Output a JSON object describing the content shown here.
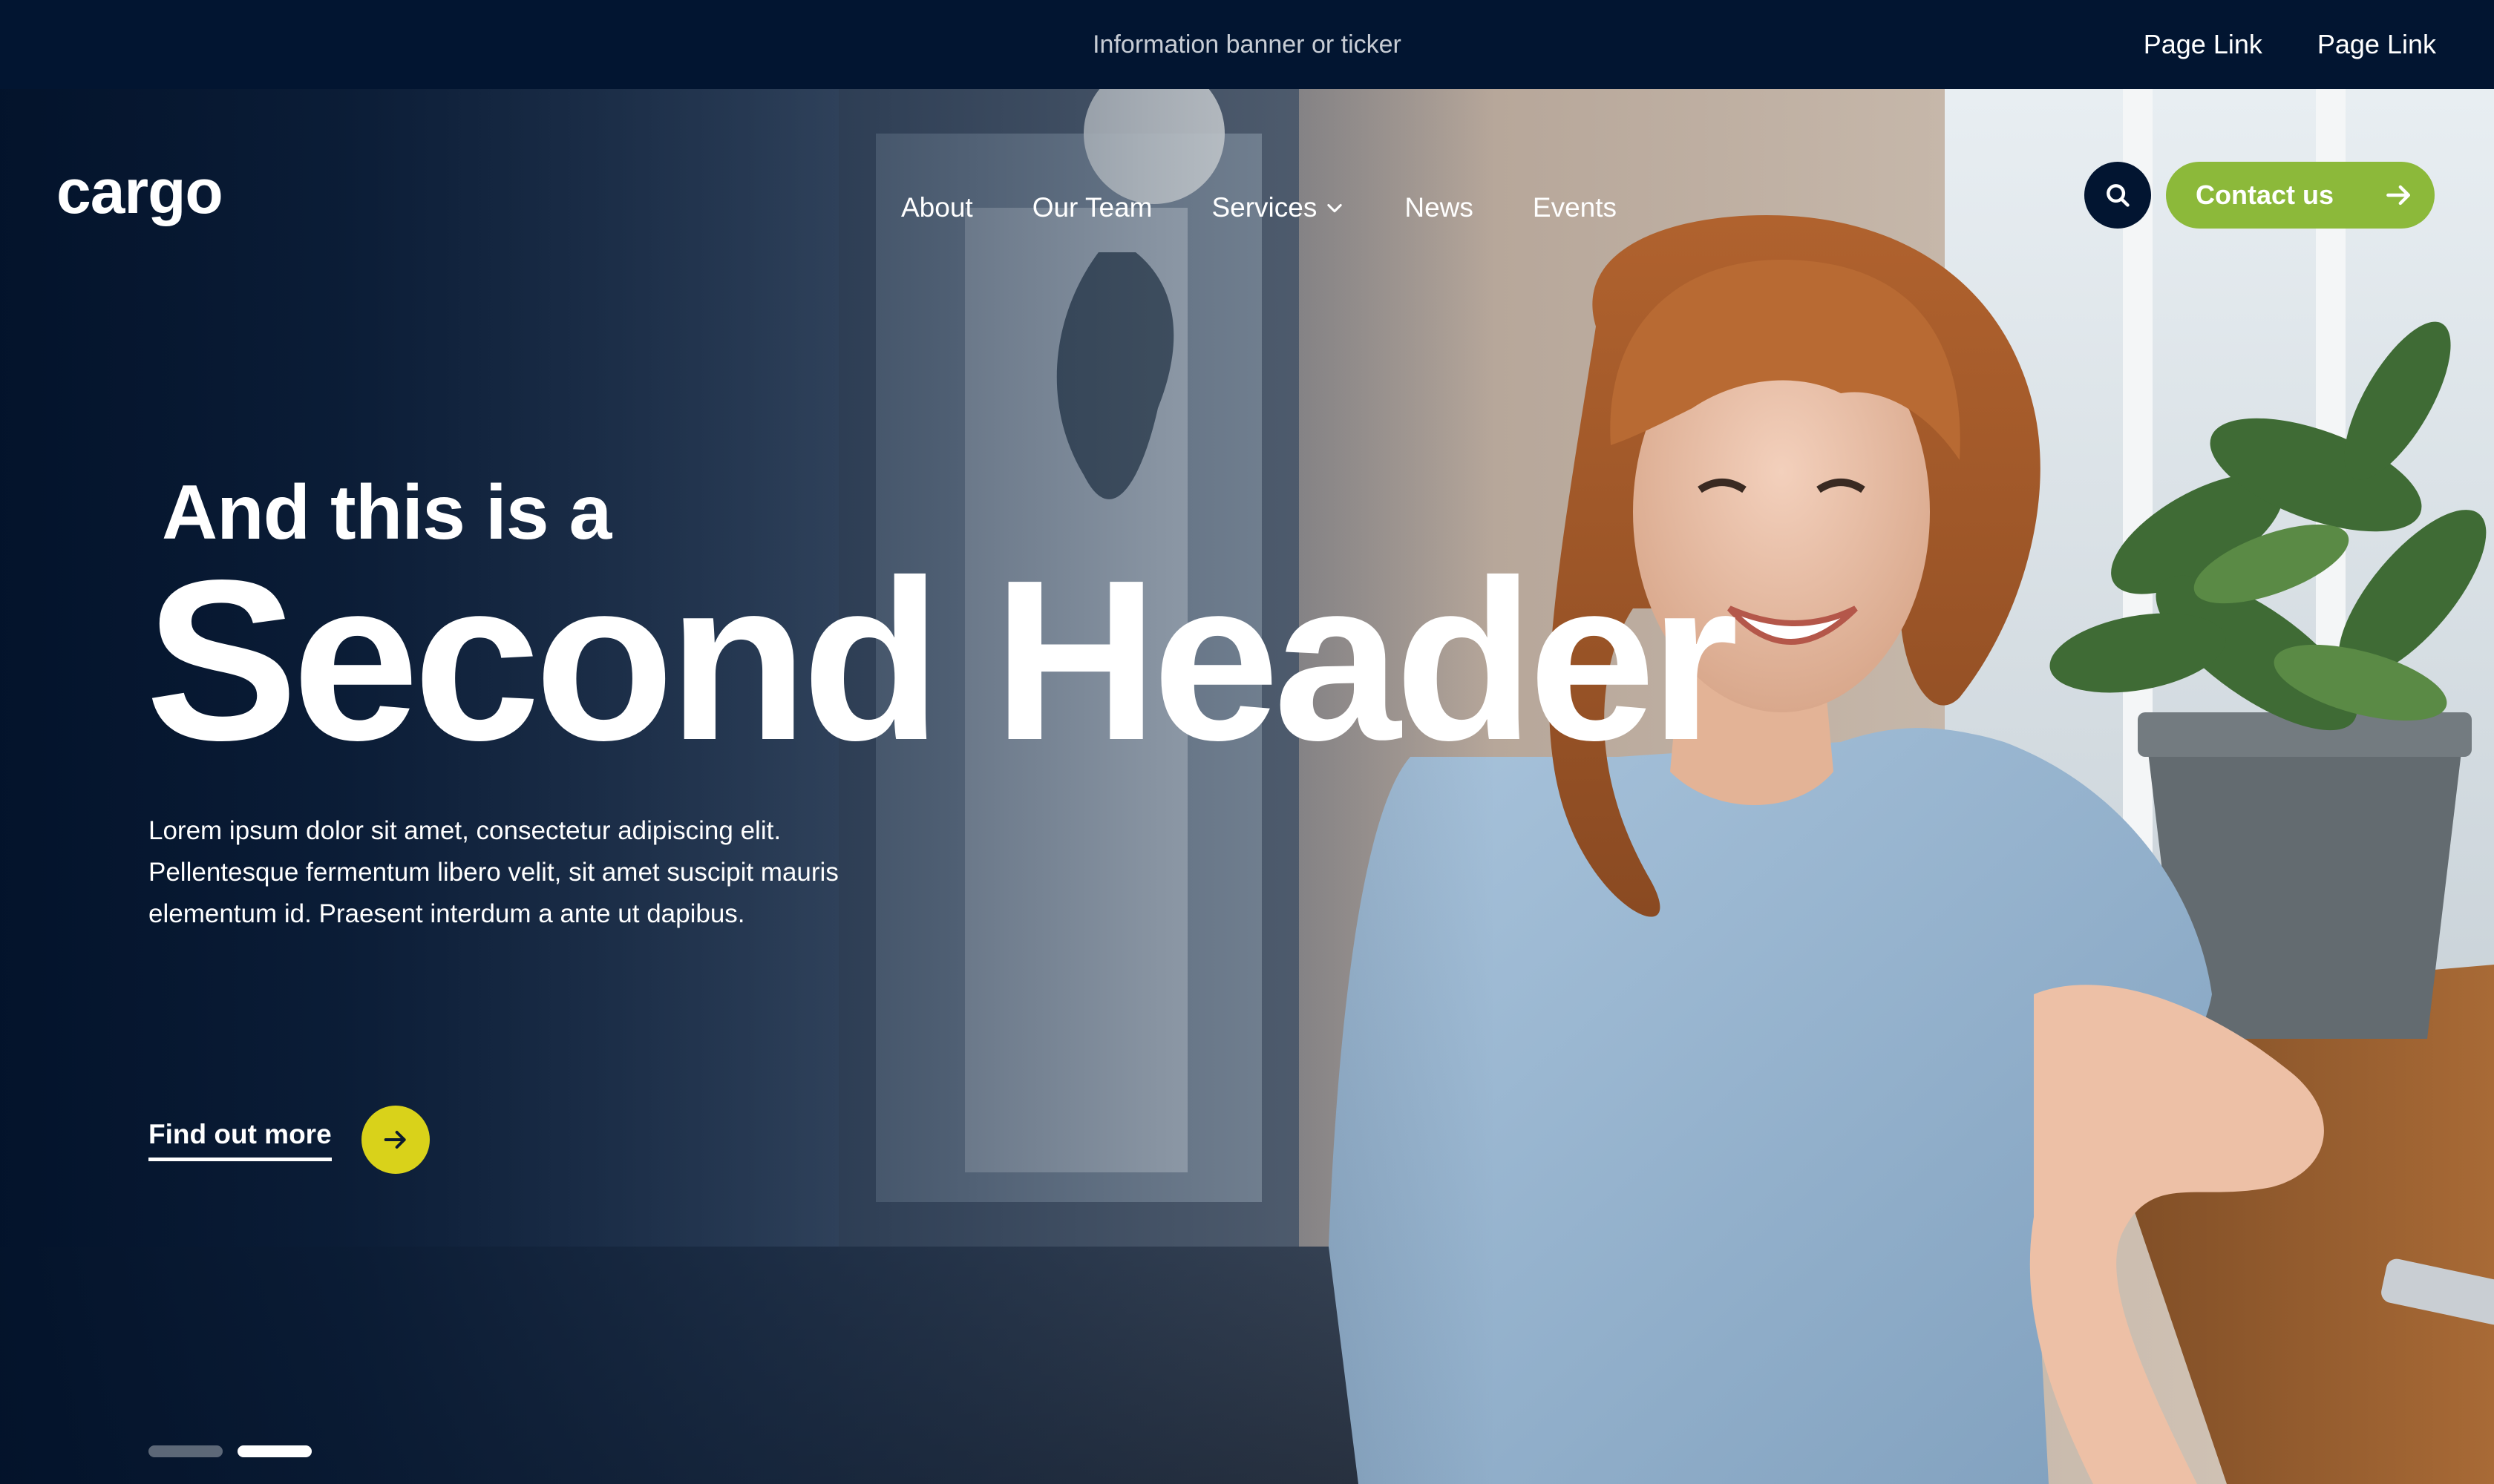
{
  "banner": {
    "text": "Information banner or ticker",
    "links": [
      "Page Link",
      "Page Link"
    ]
  },
  "header": {
    "logo": "cargo",
    "nav": [
      "About",
      "Our Team",
      "Services",
      "News",
      "Events"
    ],
    "contact_label": "Contact us"
  },
  "hero": {
    "kicker": "And this is a",
    "title": "Second Header",
    "body": "Lorem ipsum dolor sit amet, consectetur adipiscing elit. Pellentesque fermentum libero velit, sit amet suscipit mauris elementum id. Praesent interdum a ante ut dapibus.",
    "cta_label": "Find out more",
    "slides_total": 2,
    "active_slide": 2
  },
  "colors": {
    "banner_bg": "#021531",
    "accent_green": "#8cb93a",
    "accent_yellow": "#d9d21a"
  },
  "icons": [
    "search-icon",
    "arrow-right-icon",
    "chevron-down-icon"
  ]
}
